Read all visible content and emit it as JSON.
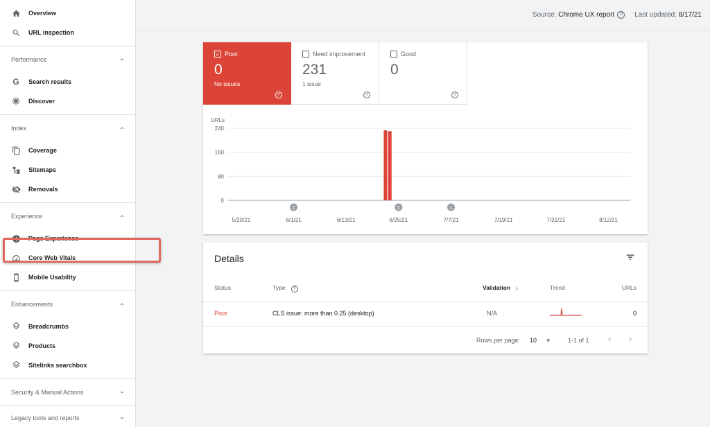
{
  "sidebar": {
    "top_items": [
      {
        "label": "Overview",
        "icon": "home-icon"
      },
      {
        "label": "URL inspection",
        "icon": "search-icon"
      }
    ],
    "sections": [
      {
        "title": "Performance",
        "expanded": true,
        "items": [
          {
            "label": "Search results",
            "icon": "google-g-icon"
          },
          {
            "label": "Discover",
            "icon": "asterisk-icon"
          }
        ]
      },
      {
        "title": "Index",
        "expanded": true,
        "items": [
          {
            "label": "Coverage",
            "icon": "copy-icon"
          },
          {
            "label": "Sitemaps",
            "icon": "sitemap-icon"
          },
          {
            "label": "Removals",
            "icon": "eye-off-icon"
          }
        ]
      },
      {
        "title": "Experience",
        "expanded": true,
        "items": [
          {
            "label": "Page Experience",
            "icon": "plus-circle-icon"
          },
          {
            "label": "Core Web Vitals",
            "icon": "gauge-icon"
          },
          {
            "label": "Mobile Usability",
            "icon": "phone-icon"
          }
        ]
      },
      {
        "title": "Enhancements",
        "expanded": true,
        "items": [
          {
            "label": "Breadcrumbs",
            "icon": "layers-icon"
          },
          {
            "label": "Products",
            "icon": "layers-icon"
          },
          {
            "label": "Sitelinks searchbox",
            "icon": "layers-icon"
          }
        ]
      },
      {
        "title": "Security & Manual Actions",
        "expanded": false,
        "items": []
      },
      {
        "title": "Legacy tools and reports",
        "expanded": false,
        "items": []
      }
    ]
  },
  "topbar": {
    "source_label": "Source:",
    "source_value": "Chrome UX report",
    "updated_label": "Last updated:",
    "updated_value": "8/17/21"
  },
  "tiles": [
    {
      "label": "Poor",
      "value": "0",
      "sub": "No issues",
      "checked": true
    },
    {
      "label": "Need improvement",
      "value": "231",
      "sub": "1 issue",
      "checked": false
    },
    {
      "label": "Good",
      "value": "0",
      "sub": "",
      "checked": false
    }
  ],
  "chart_data": {
    "type": "bar",
    "ylabel": "URLs",
    "ylim": [
      0,
      240
    ],
    "yticks": [
      0,
      80,
      160,
      240
    ],
    "x_ticks": [
      "5/20/21",
      "6/1/21",
      "6/13/21",
      "6/25/21",
      "7/7/21",
      "7/19/21",
      "7/31/21",
      "8/12/21"
    ],
    "x_start": "2021-05-17",
    "x_end": "2021-08-17",
    "series": [
      {
        "values": [
          {
            "date": "2021-06-22",
            "value": 233
          },
          {
            "date": "2021-06-23",
            "value": 230
          }
        ]
      }
    ],
    "annotations": [
      {
        "date": "2021-06-01",
        "label": "1"
      },
      {
        "date": "2021-06-25",
        "label": "1"
      },
      {
        "date": "2021-07-07",
        "label": "1"
      }
    ],
    "bar_color": "#db4437",
    "grid": true
  },
  "details": {
    "title": "Details",
    "columns": {
      "status": "Status",
      "type": "Type",
      "validation": "Validation",
      "trend": "Trend",
      "urls": "URLs"
    },
    "rows": [
      {
        "status": "Poor",
        "type": "CLS issue: more than 0.25 (desktop)",
        "validation": "N/A",
        "urls": "0"
      }
    ],
    "footer": {
      "rows_per_page_label": "Rows per page:",
      "rows_per_page": "10",
      "range": "1-1 of 1"
    }
  },
  "colors": {
    "poor": "#db4437",
    "highlight": "#e0685c"
  }
}
